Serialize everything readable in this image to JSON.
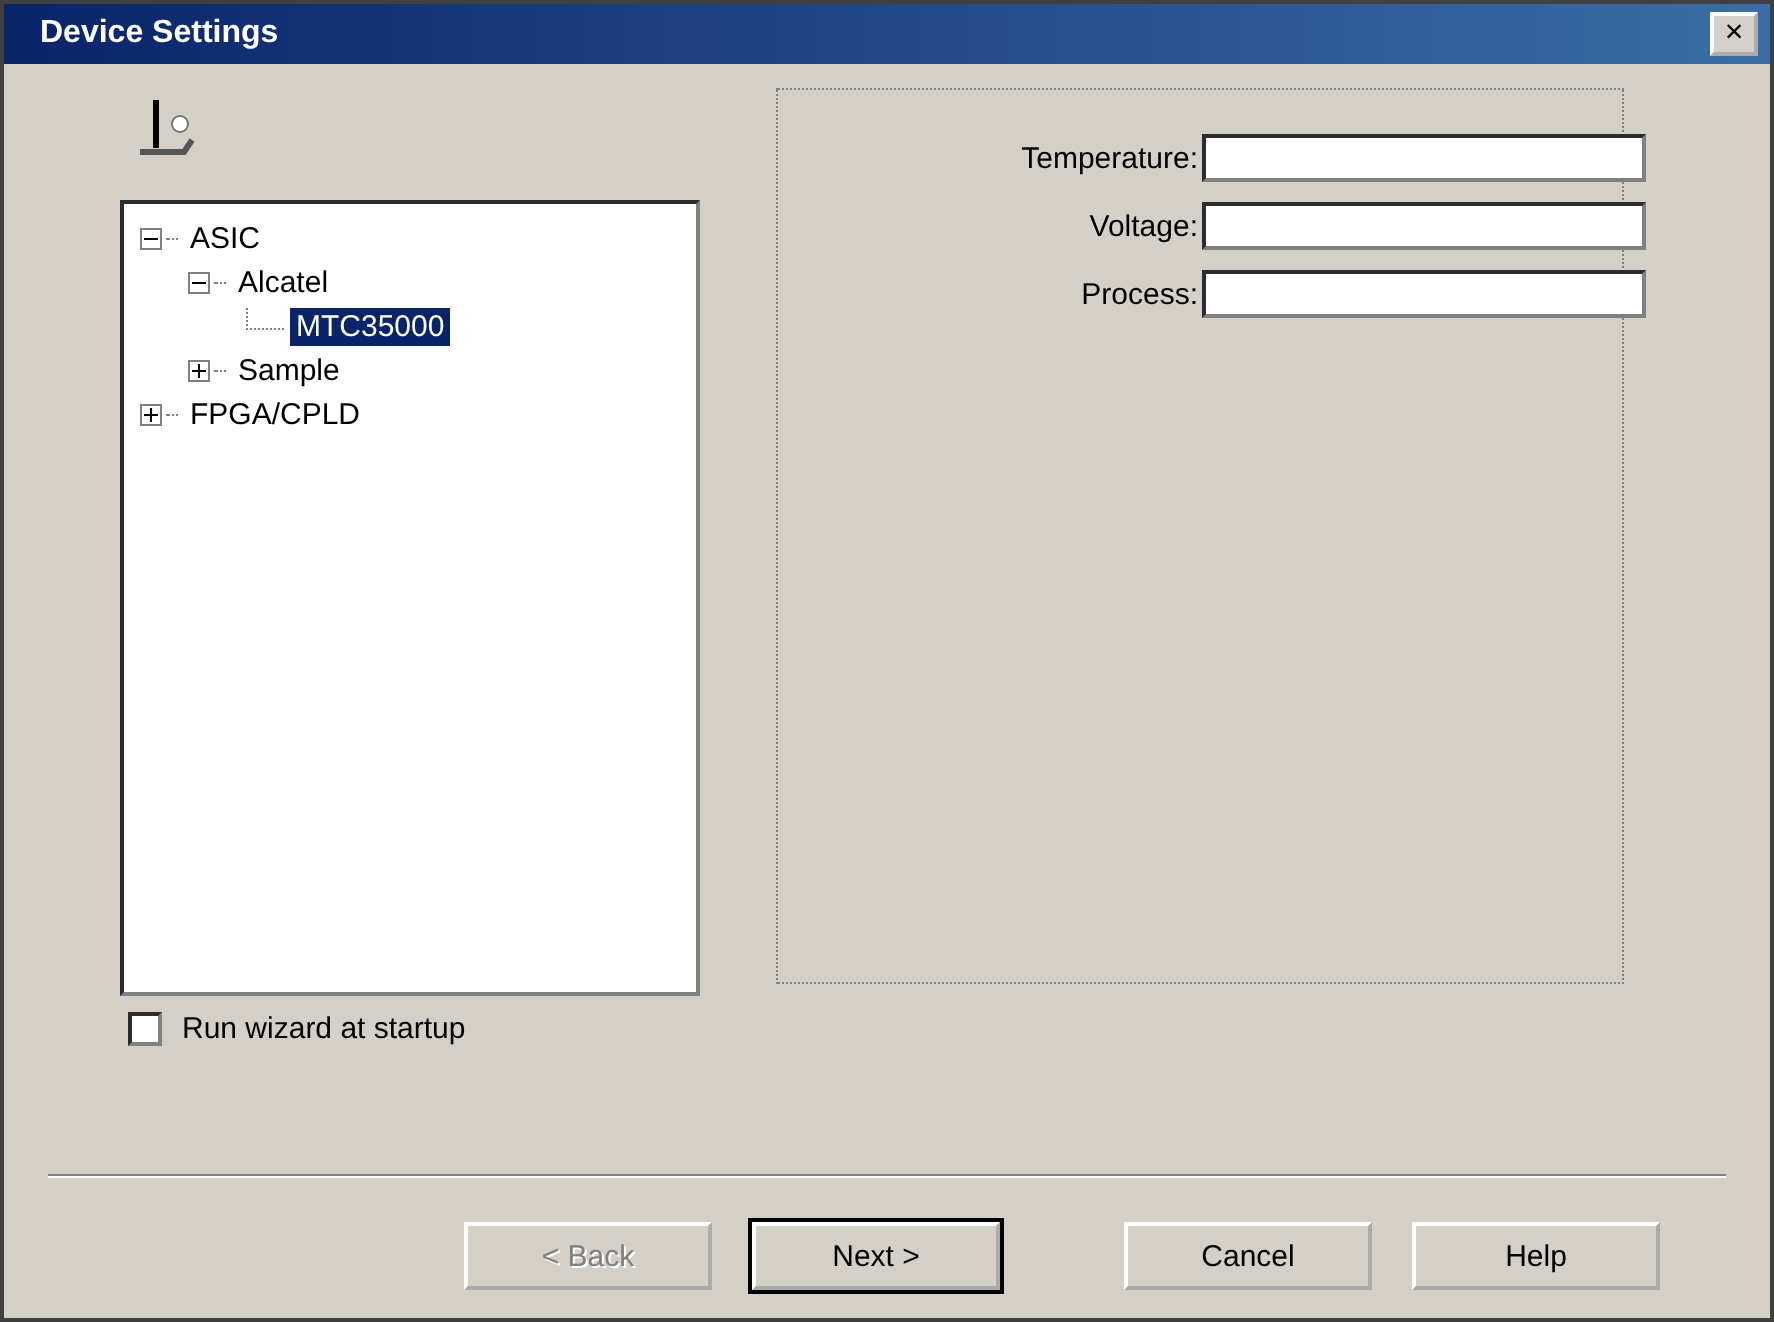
{
  "window": {
    "title": "Device Settings",
    "close": "×"
  },
  "tree": [
    {
      "label": "ASIC",
      "expanded": true,
      "selected": false,
      "children": [
        {
          "label": "Alcatel",
          "expanded": true,
          "selected": false,
          "children": [
            {
              "label": "MTC35000",
              "selected": true
            }
          ]
        },
        {
          "label": "Sample",
          "expanded": false,
          "selected": false
        }
      ]
    },
    {
      "label": "FPGA/CPLD",
      "expanded": false,
      "selected": false
    }
  ],
  "fields": [
    {
      "label": "Temperature:"
    },
    {
      "label": "Voltage:"
    },
    {
      "label": "Process:"
    }
  ],
  "startup_checkbox": {
    "label": "Run wizard at startup",
    "checked": false
  },
  "buttons": [
    {
      "label": "< Back",
      "disabled": true,
      "default": false
    },
    {
      "label": "Next >",
      "disabled": false,
      "default": true
    },
    {
      "label": "Cancel",
      "disabled": false,
      "default": false
    },
    {
      "label": "Help",
      "disabled": false,
      "default": false
    }
  ]
}
